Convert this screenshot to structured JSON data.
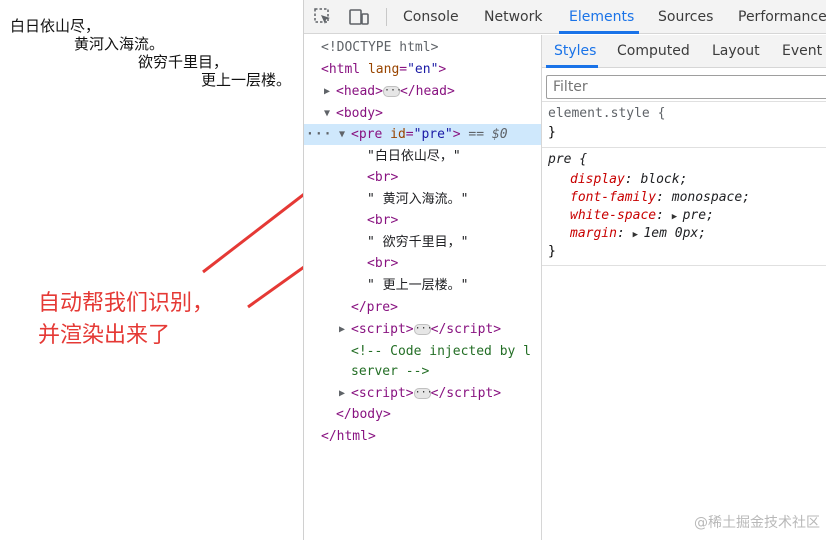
{
  "poem": {
    "lines": [
      "白日依山尽，",
      "黄河入海流。",
      "欲穷千里目，",
      "更上一层楼。"
    ]
  },
  "annotation": {
    "text_line1": "自动帮我们识别，",
    "text_line2": "并渲染出来了",
    "color": "#e53935"
  },
  "devtools": {
    "tabs": [
      {
        "label": "Console",
        "active": false
      },
      {
        "label": "Network",
        "active": false
      },
      {
        "label": "Elements",
        "active": true
      },
      {
        "label": "Sources",
        "active": false
      },
      {
        "label": "Performance",
        "active": false
      }
    ],
    "accent_color": "#1a73e8",
    "elements": {
      "doctype": "<!DOCTYPE html>",
      "html_open_tag": "html",
      "html_lang_attr": "lang",
      "html_lang_val": "\"en\"",
      "head_tag": "head",
      "body_tag": "body",
      "pre_tag": "pre",
      "pre_id_attr": "id",
      "pre_id_val": "\"pre\"",
      "selected_marker": "== $0",
      "text_nodes": [
        "\"白日依山尽，\"",
        "\" 黄河入海流。\"",
        "\" 欲穷千里目，\"",
        "\" 更上一层楼。\""
      ],
      "br_tag": "<br>",
      "pre_close": "</pre>",
      "script_tag": "script",
      "comment_line1": "<!-- Code injected by l",
      "comment_line2": "server -->",
      "body_close": "</body>",
      "html_close": "</html>"
    },
    "styles_panel": {
      "tabs": [
        {
          "label": "Styles",
          "active": true
        },
        {
          "label": "Computed",
          "active": false
        },
        {
          "label": "Layout",
          "active": false
        },
        {
          "label": "Event L",
          "active": false
        }
      ],
      "filter_placeholder": "Filter",
      "element_style_selector": "element.style {",
      "close_brace": "}",
      "pre_selector": "pre {",
      "declarations": [
        {
          "prop": "display",
          "value": "block;",
          "expandable": false
        },
        {
          "prop": "font-family",
          "value": "monospace;",
          "expandable": false
        },
        {
          "prop": "white-space",
          "value": "pre;",
          "expandable": true
        },
        {
          "prop": "margin",
          "value": "1em 0px;",
          "expandable": true
        }
      ]
    }
  },
  "watermark": "@稀土掘金技术社区"
}
